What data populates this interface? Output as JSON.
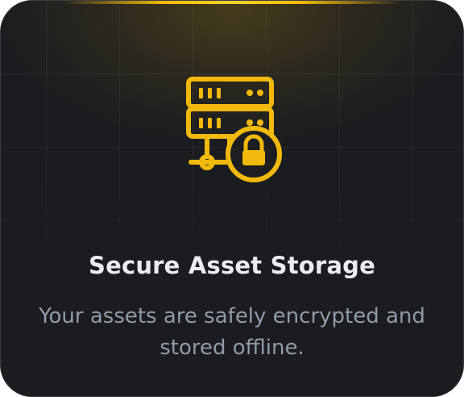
{
  "card": {
    "icon": "server-lock-icon",
    "title": "Secure Asset Storage",
    "description": "Your assets are safely encrypted and stored offline."
  },
  "colors": {
    "accent": "#f0b90b",
    "background": "#1b1c20",
    "title": "#eaecef",
    "description": "#929aa5"
  }
}
